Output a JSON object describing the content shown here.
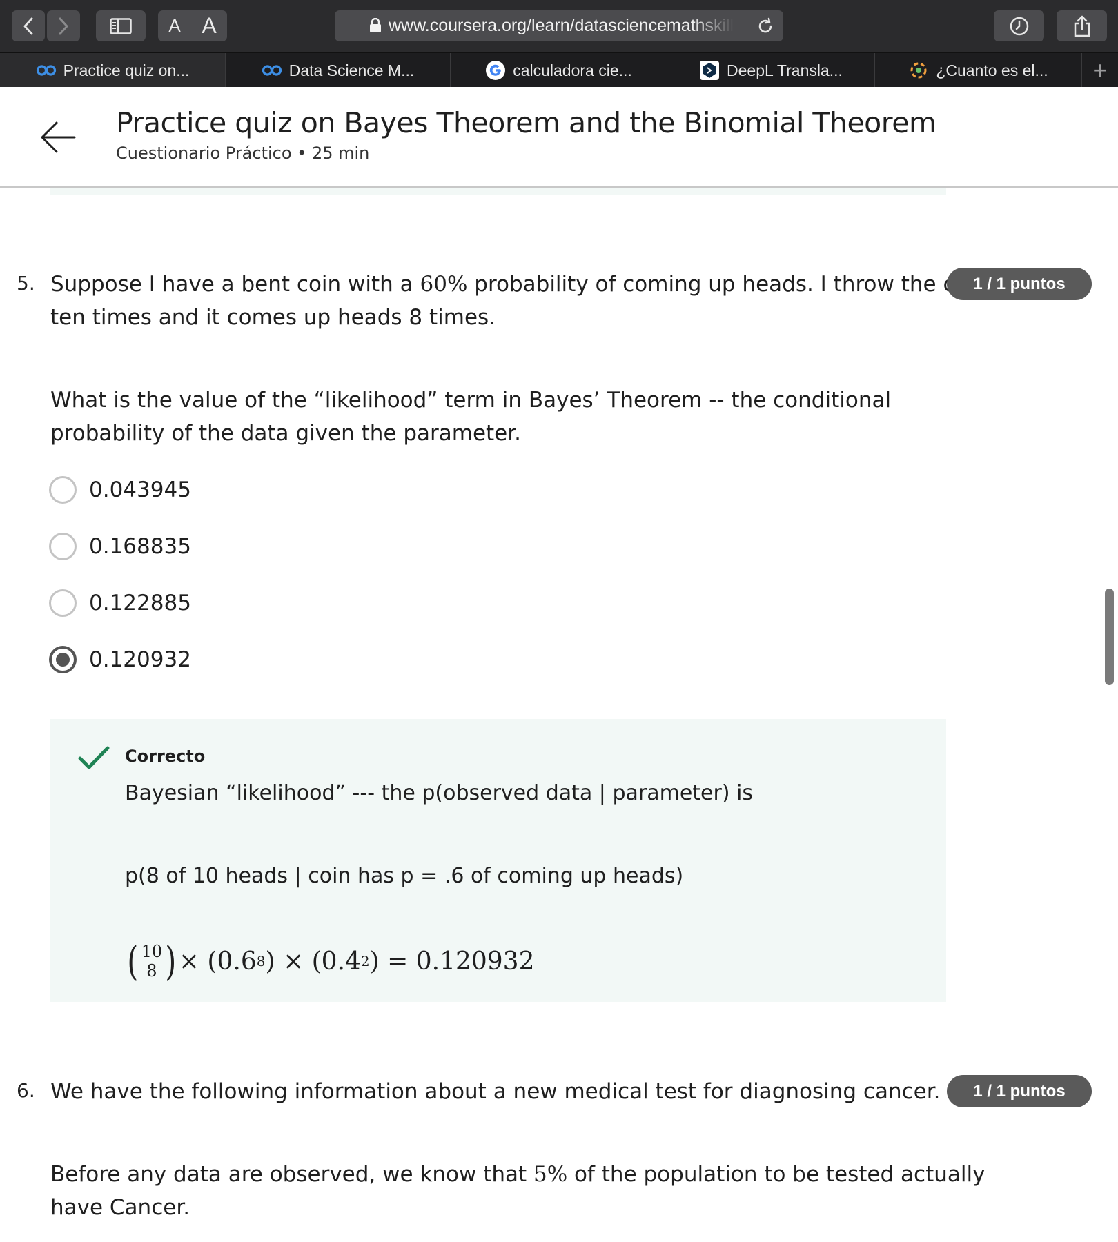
{
  "browser": {
    "url": "www.coursera.org/learn/datasciencemathskills",
    "font_small_label": "A",
    "font_large_label": "A"
  },
  "tabs": [
    {
      "label": "Practice quiz on...",
      "icon": "coursera-icon",
      "active": true
    },
    {
      "label": "Data Science M...",
      "icon": "coursera-icon",
      "active": false
    },
    {
      "label": "calculadora cie...",
      "icon": "google-icon",
      "active": false
    },
    {
      "label": "DeepL Transla...",
      "icon": "deepl-icon",
      "active": false
    },
    {
      "label": "¿Cuanto es el...",
      "icon": "loader-icon",
      "active": false
    }
  ],
  "header": {
    "title": "Practice quiz on Bayes Theorem and the Binomial Theorem",
    "subtitle": "Cuestionario Práctico • 25 min"
  },
  "q5": {
    "number": "5.",
    "points": "1 / 1 puntos",
    "text_pre": "Suppose I have a bent coin with a ",
    "text_math": "60%",
    "text_post": " probability of coming up heads. I throw the coin",
    "text_line2": "ten times and it comes up heads 8 times.",
    "prompt_line1": "What is the value of the “likelihood” term in Bayes’ Theorem -- the conditional",
    "prompt_line2": "probability of the data given the parameter.",
    "options": [
      {
        "label": "0.043945",
        "selected": false
      },
      {
        "label": "0.168835",
        "selected": false
      },
      {
        "label": "0.122885",
        "selected": false
      },
      {
        "label": "0.120932",
        "selected": true
      }
    ],
    "feedback": {
      "status": "Correcto",
      "line1": "Bayesian “likelihood” --- the p(observed data | parameter) is",
      "line2": "p(8 of 10 heads | coin has p = .6 of coming up heads)",
      "binom_top": "10",
      "binom_bottom": "8",
      "m1": " × (0.6",
      "e1": "8",
      "m2": ") × (0.4",
      "e2": "2",
      "m3": ") = 0.120932"
    }
  },
  "q6": {
    "number": "6.",
    "points": "1 / 1 puntos",
    "text": "We have the following information about a new medical test for diagnosing cancer.",
    "para_pre": "Before any data are observed, we know that ",
    "para_math": "5%",
    "para_post": " of the population to be tested actually",
    "para_line2": "have Cancer."
  },
  "colors": {
    "check": "#1f8354",
    "badge": "#5a5a5a",
    "feedback_bg": "#f2f8f6"
  }
}
